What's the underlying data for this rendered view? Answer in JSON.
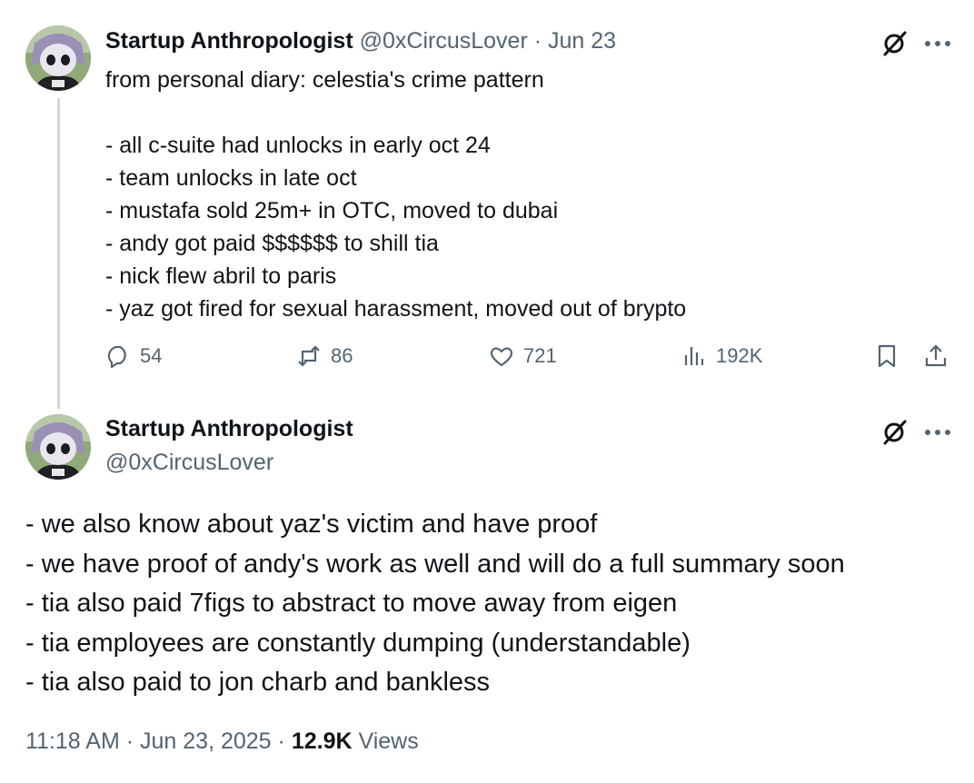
{
  "tweet1": {
    "author_name": "Startup Anthropologist",
    "handle": "@0xCircusLover",
    "separator": "·",
    "date": "Jun 23",
    "lines": [
      "from personal diary: celestia's crime pattern",
      "",
      "- all c-suite had unlocks in early oct 24",
      "- team unlocks in late oct",
      "- mustafa sold 25m+ in OTC, moved to dubai",
      "- andy got paid $$$$$$ to shill tia",
      "- nick flew abril to paris",
      "- yaz got fired for sexual harassment, moved out of brypto"
    ],
    "stats": {
      "replies": "54",
      "reposts": "86",
      "likes": "721",
      "views": "192K"
    }
  },
  "tweet2": {
    "author_name": "Startup Anthropologist",
    "handle": "@0xCircusLover",
    "lines": [
      "- we also know about yaz's victim and have proof",
      "- we have proof of andy's work as well and will do a full summary soon",
      "- tia also paid 7figs to abstract to move away from eigen",
      "- tia employees are constantly dumping (understandable)",
      "- tia also paid to jon charb and bankless"
    ],
    "time": "11:18 AM",
    "separator": "·",
    "date": "Jun 23, 2025",
    "separator2": "·",
    "views_count": "12.9K",
    "views_label": "Views"
  },
  "icons": {
    "grok": "grok-slash-icon",
    "more": "more-dots-icon",
    "reply": "reply-bubble-icon",
    "repost": "repost-arrows-icon",
    "like": "heart-icon",
    "views": "bar-chart-icon",
    "bookmark": "bookmark-icon",
    "share": "share-upload-icon"
  },
  "colors": {
    "text": "#0f1419",
    "muted": "#536471",
    "thread_line": "#cfd9de"
  }
}
